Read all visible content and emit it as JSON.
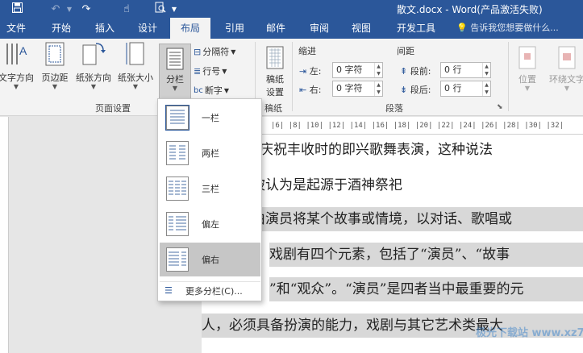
{
  "title_bar": {
    "doc_title": "散文.docx - Word(产品激活失败)",
    "qat": {
      "save_icon": "save-icon",
      "undo_glyph": "↶",
      "redo_glyph": "↷",
      "touch_glyph": "☝",
      "preview_glyph": "🔍"
    }
  },
  "tabs": [
    {
      "label": "文件"
    },
    {
      "label": "开始"
    },
    {
      "label": "插入"
    },
    {
      "label": "设计"
    },
    {
      "label": "布局"
    },
    {
      "label": "引用"
    },
    {
      "label": "邮件"
    },
    {
      "label": "审阅"
    },
    {
      "label": "视图"
    },
    {
      "label": "开发工具"
    }
  ],
  "tell_me": "告诉我您想要做什么...",
  "ribbon": {
    "page_setup": {
      "group_label": "页面设置",
      "text_direction": "文字方向",
      "margins": "页边距",
      "orientation": "纸张方向",
      "size": "纸张大小",
      "columns": "分栏",
      "breaks": "分隔符",
      "line_numbers": "行号",
      "hyphenation": "断字"
    },
    "draft": {
      "group_label": "稿纸",
      "draft_settings_1": "稿纸",
      "draft_settings_2": "设置"
    },
    "paragraph": {
      "group_label": "段落",
      "indent_header": "缩进",
      "spacing_header": "间距",
      "indent_left_label": "左:",
      "indent_left_value": "0 字符",
      "indent_right_label": "右:",
      "indent_right_value": "0 字符",
      "spacing_before_label": "段前:",
      "spacing_before_value": "0 行",
      "spacing_after_label": "段后:",
      "spacing_after_value": "0 行"
    },
    "arrange": {
      "position": "位置",
      "wrap_text": "环绕文字"
    }
  },
  "ruler": {
    "corner": "L",
    "ticks": "|6|  |8|  |10|  |12|  |14|  |16|  |18|  |20|  |22|  |24|  |26|  |28|  |30|  |32|"
  },
  "document": {
    "lines": [
      "动或庆祝丰收时的即兴歌舞表演，这种说法",
      "被认为是起源于酒神祭祀",
      "由演员将某个故事或情境，以对话、歌唱或",
      "戏剧有四个元素，包括了“演员”、“故事",
      "”和“观众”。“演员”是四者当中最重要的元",
      "人，必须具备扮演的能力，戏剧与其它艺术类最大"
    ]
  },
  "columns_menu": {
    "items": [
      {
        "label": "一栏"
      },
      {
        "label": "两栏"
      },
      {
        "label": "三栏"
      },
      {
        "label": "偏左"
      },
      {
        "label": "偏右"
      }
    ],
    "more": "更多分栏(C)..."
  },
  "watermark": "极光下载站 www.xz7.com",
  "colors": {
    "brand_blue": "#2b579a",
    "ribbon_bg": "#f3f3f3",
    "hover_gray": "#c6c6c6"
  }
}
